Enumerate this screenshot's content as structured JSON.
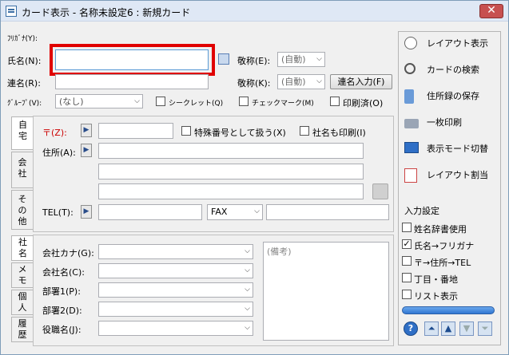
{
  "title": "カード表示 - 名称未設定6 : 新規カード",
  "close": "✕",
  "header": {
    "furigana_label": "ﾌﾘｶﾞﾅ(Y):",
    "name_label": "氏名(N):",
    "name_value": "",
    "renmei_label": "連名(R):",
    "group_label": "ｸﾞﾙｰﾌﾟ(V):",
    "group_value": "(なし)",
    "keisho_e_label": "敬称(E):",
    "keisho_e_value": "(自動)",
    "keisho_k_label": "敬称(K):",
    "keisho_k_value": "(自動)",
    "renmei_input_button": "連名入力(F)",
    "secret_label": "シークレット(Q)",
    "checkmark_label": "チェックマーク(M)",
    "printed_label": "印刷済(O)"
  },
  "tabs_top": [
    "自宅",
    "会社",
    "その他"
  ],
  "tabs_bottom": [
    "社名",
    "メモ",
    "個人",
    "履歴"
  ],
  "address": {
    "zip_label": "〒(Z):",
    "special_label": "特殊番号として扱う(X)",
    "company_print_label": "社名も印刷(I)",
    "address_label": "住所(A):",
    "tel_label": "TEL(T):",
    "fax_value": "FAX"
  },
  "company": {
    "kana_label": "会社カナ(G):",
    "name_label": "会社名(C):",
    "dept1_label": "部署1(P):",
    "dept2_label": "部署2(D):",
    "title_label": "役職名(J):",
    "memo_placeholder": "(備考)"
  },
  "sidebar": {
    "buttons": [
      {
        "label": "レイアウト表示",
        "icon": "layout-preview-icon"
      },
      {
        "label": "カードの検索",
        "icon": "search-card-icon"
      },
      {
        "label": "住所録の保存",
        "icon": "save-addressbook-icon"
      },
      {
        "label": "一枚印刷",
        "icon": "printer-icon"
      },
      {
        "label": "表示モード切替",
        "icon": "display-mode-icon"
      },
      {
        "label": "レイアウト割当",
        "icon": "layout-assign-icon"
      }
    ],
    "input_settings_label": "入力設定",
    "options": [
      {
        "label": "姓名辞書使用",
        "checked": false
      },
      {
        "label": "氏名→フリガナ",
        "checked": true
      },
      {
        "label": "〒→住所→TEL",
        "checked": false
      },
      {
        "label": "丁目・番地",
        "checked": false
      },
      {
        "label": "リスト表示",
        "checked": false
      }
    ],
    "nav": [
      "?",
      "⏶",
      "▲",
      "▼",
      "⏷"
    ]
  }
}
